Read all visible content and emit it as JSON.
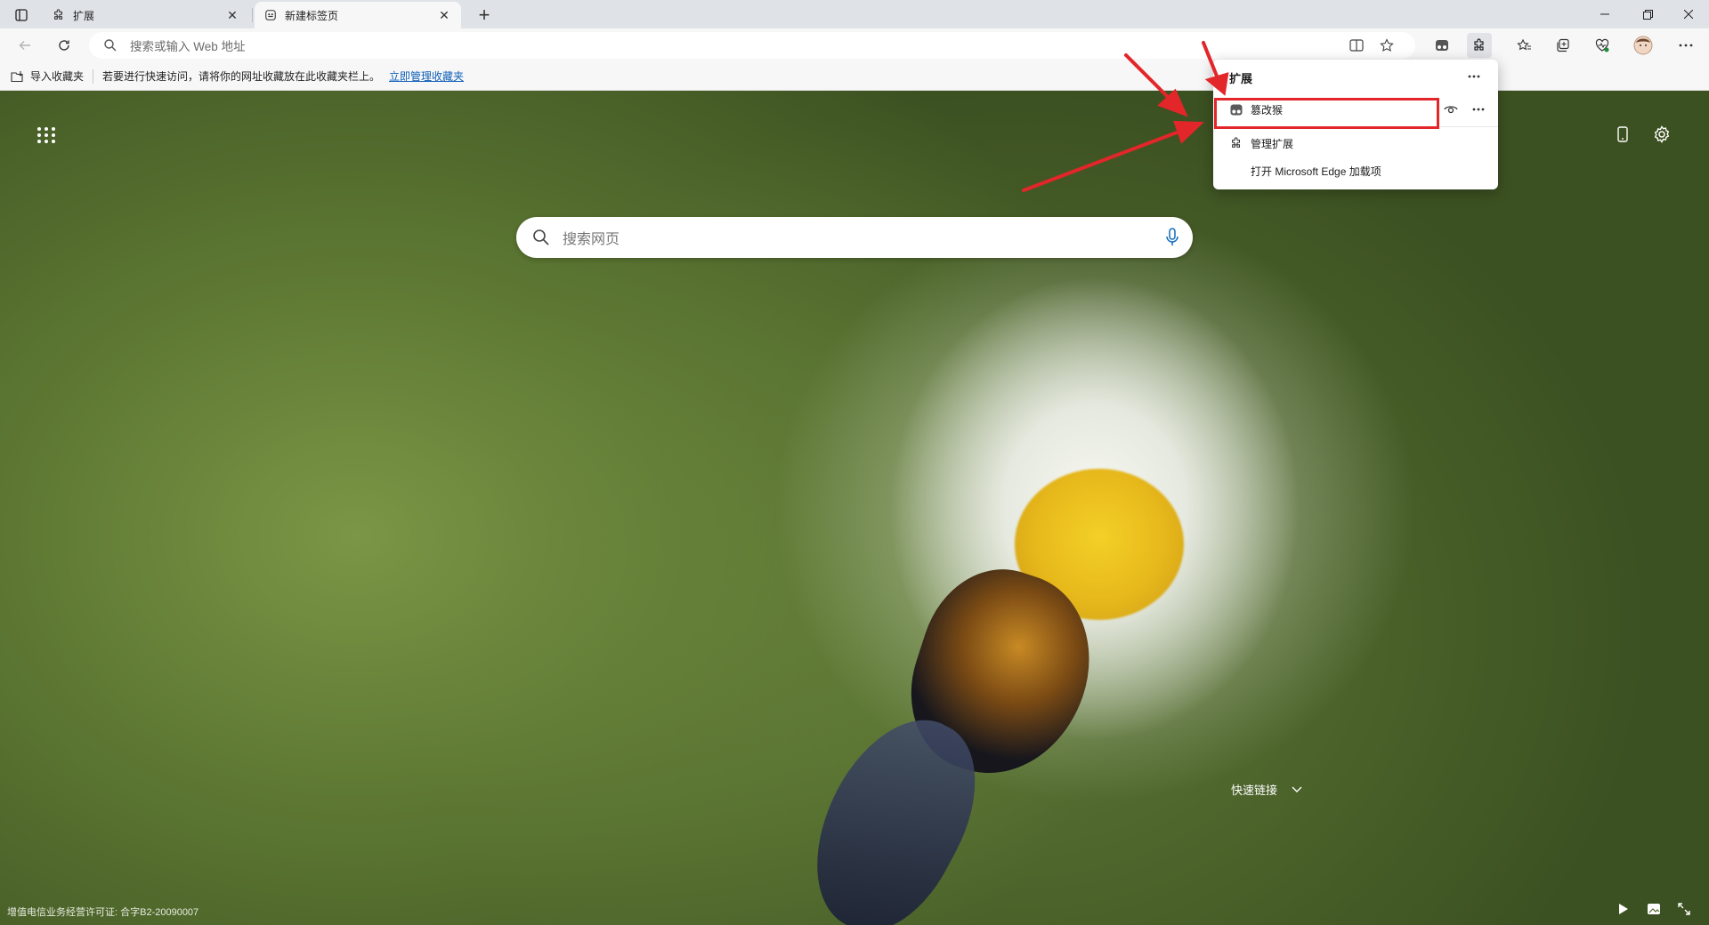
{
  "tabs": [
    {
      "title": "扩展",
      "icon": "puzzle-icon",
      "active": false
    },
    {
      "title": "新建标签页",
      "icon": "newtab-page-icon",
      "active": true
    }
  ],
  "address_bar": {
    "placeholder": "搜索或输入 Web 地址"
  },
  "favorites_bar": {
    "import_label": "导入收藏夹",
    "hint": "若要进行快速访问，请将你的网址收藏放在此收藏夹栏上。",
    "manage_link": "立即管理收藏夹"
  },
  "extensions_popup": {
    "title": "扩展",
    "items": [
      {
        "name": "篡改猴",
        "icon": "tampermonkey-icon"
      }
    ],
    "manage_label": "管理扩展",
    "addons_label": "打开 Microsoft Edge 加载项"
  },
  "newtab": {
    "search_placeholder": "搜索网页",
    "quick_links_label": "快速链接",
    "footer_license": "增值电信业务经营许可证: 合字B2-20090007"
  },
  "colors": {
    "highlight": "#e3262a",
    "link": "#0f5fb7"
  }
}
